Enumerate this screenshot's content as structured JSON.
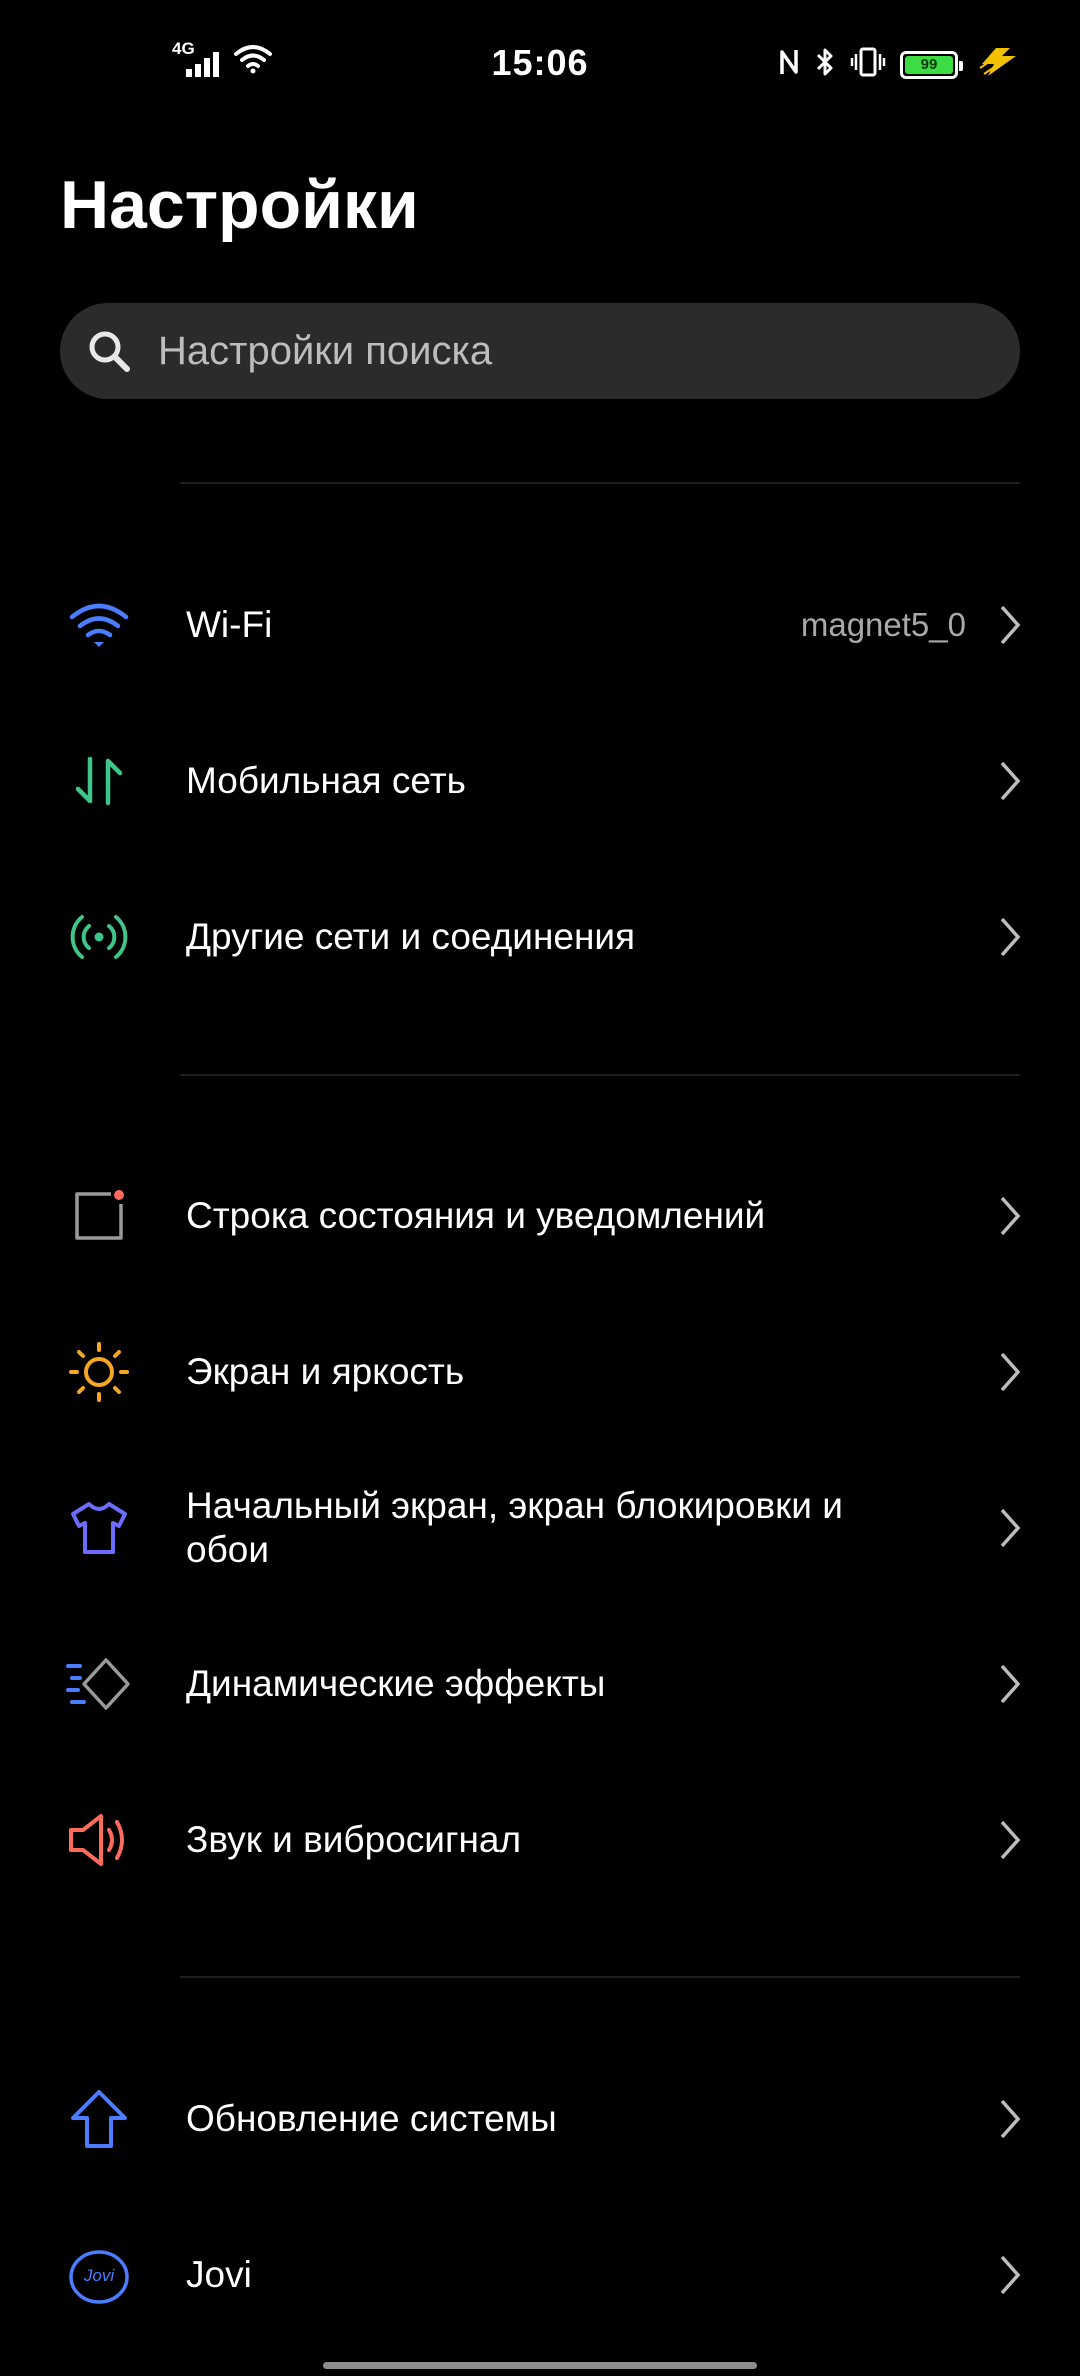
{
  "status_bar": {
    "time": "15:06",
    "network_label": "4G",
    "battery_level": "99",
    "colors": {
      "battery": "#3ddc44",
      "charging": "#f2c200"
    }
  },
  "page_title": "Настройки",
  "search": {
    "placeholder": "Настройки поиска"
  },
  "groups": [
    {
      "items": [
        {
          "label": "Wi-Fi",
          "value": "magnet5_0",
          "icon": "wifi-icon",
          "color": "#4a7dff"
        },
        {
          "label": "Мобильная сеть",
          "icon": "mobile-data-icon",
          "color": "#3fc48a"
        },
        {
          "label": "Другие сети и соединения",
          "icon": "connections-icon",
          "color": "#3fc48a"
        }
      ]
    },
    {
      "items": [
        {
          "label": "Строка состояния и уведомлений",
          "icon": "notification-icon",
          "color": "#ff6b5a"
        },
        {
          "label": "Экран и яркость",
          "icon": "brightness-icon",
          "color": "#f5a623"
        },
        {
          "label": "Начальный экран, экран блокировки и обои",
          "icon": "theme-shirt-icon",
          "color": "#6c6cff"
        },
        {
          "label": "Динамические эффекты",
          "icon": "dynamic-effects-icon",
          "color": "#4a7dff"
        },
        {
          "label": "Звук и вибросигнал",
          "icon": "sound-icon",
          "color": "#ff6b5a"
        }
      ]
    },
    {
      "items": [
        {
          "label": "Обновление системы",
          "icon": "system-update-icon",
          "color": "#4a7dff"
        },
        {
          "label": "Jovi",
          "icon": "jovi-icon",
          "icon_text": "Jovi",
          "color": "#4a7dff"
        }
      ]
    }
  ]
}
